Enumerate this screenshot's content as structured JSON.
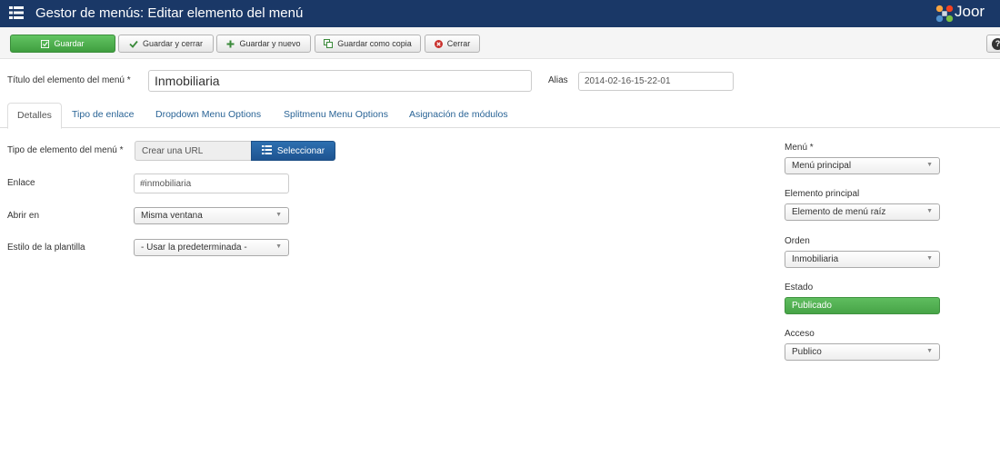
{
  "header": {
    "title": "Gestor de menús: Editar elemento del menú",
    "logo_text": "Joor"
  },
  "toolbar": {
    "save_label": "Guardar",
    "save_close_label": "Guardar y cerrar",
    "save_new_label": "Guardar y nuevo",
    "save_copy_label": "Guardar como copia",
    "close_label": "Cerrar",
    "help_label": "?"
  },
  "form": {
    "title_label": "Título del elemento del menú *",
    "title_value": "Inmobiliaria",
    "alias_label": "Alias",
    "alias_value": "2014-02-16-15-22-01"
  },
  "tabs": [
    {
      "label": "Detalles"
    },
    {
      "label": "Tipo de enlace"
    },
    {
      "label": "Dropdown Menu Options"
    },
    {
      "label": "Splitmenu Menu Options"
    },
    {
      "label": "Asignación de módulos"
    }
  ],
  "details": {
    "type_label": "Tipo de elemento del menú *",
    "type_value": "Crear una URL",
    "select_button_label": "Seleccionar",
    "link_label": "Enlace",
    "link_value": "#inmobiliaria",
    "open_in_label": "Abrir en",
    "open_in_value": "Misma ventana",
    "template_label": "Estilo de la plantilla",
    "template_value": "- Usar la predeterminada -"
  },
  "sidebar": {
    "menu_label": "Menú *",
    "menu_value": "Menú principal",
    "parent_label": "Elemento principal",
    "parent_value": "Elemento de menú raíz",
    "order_label": "Orden",
    "order_value": "Inmobiliaria",
    "status_label": "Estado",
    "status_value": "Publicado",
    "access_label": "Acceso",
    "access_value": "Publico"
  },
  "colors": {
    "header_bg": "#1a3867",
    "success": "#47a447",
    "primary": "#1e5491",
    "link": "#2a6496"
  }
}
